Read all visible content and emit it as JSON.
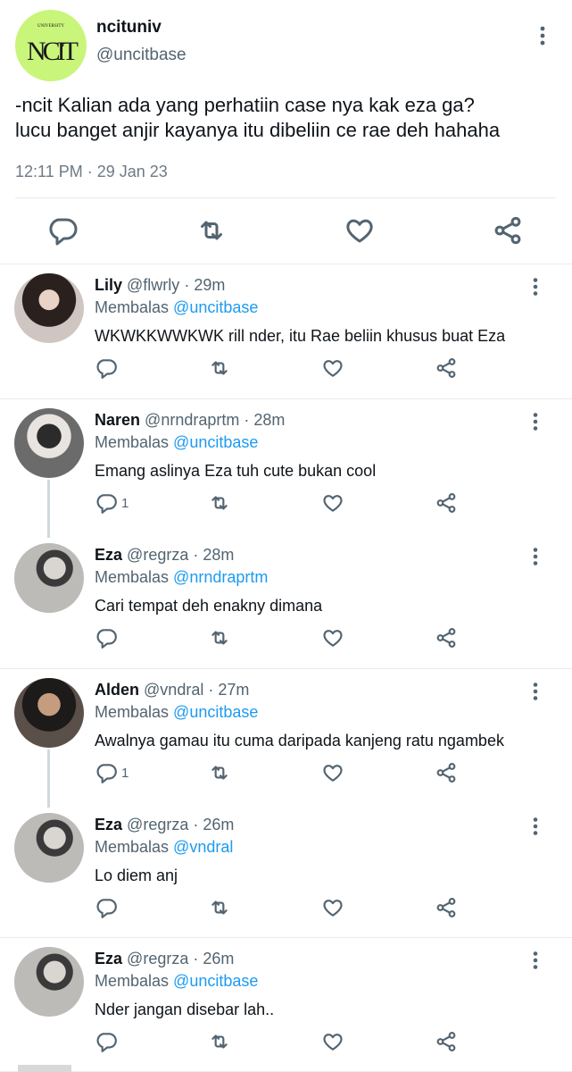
{
  "main_tweet": {
    "display_name": "ncituniv",
    "handle": "@uncitbase",
    "text_line1": "-ncit Kalian ada yang perhatiin case nya kak eza ga?",
    "text_line2": "lucu banget anjir kayanya itu dibeliin ce rae deh hahaha",
    "time": "12:11 PM",
    "separator": "·",
    "date": "29 Jan 23",
    "avatar_logo_text": "NCIT",
    "avatar_logo_subtext": "UNIVERSITY"
  },
  "replies": [
    {
      "name": "Lily",
      "handle": "@flwrly",
      "dot": "·",
      "time": "29m",
      "replying_label": "Membalas",
      "replying_to": "@uncitbase",
      "text": "WKWKKWWKWK rill nder, itu Rae beliin khusus buat Eza",
      "reply_count": ""
    },
    {
      "name": "Naren",
      "handle": "@nrndraprtm",
      "dot": "·",
      "time": "28m",
      "replying_label": "Membalas",
      "replying_to": "@uncitbase",
      "text": "Emang aslinya Eza tuh cute bukan cool",
      "reply_count": "1"
    },
    {
      "name": "Eza",
      "handle": "@regrza",
      "dot": "·",
      "time": "28m",
      "replying_label": "Membalas",
      "replying_to": "@nrndraprtm",
      "text": "Cari tempat deh enakny dimana",
      "reply_count": ""
    },
    {
      "name": "Alden",
      "handle": "@vndral",
      "dot": "·",
      "time": "27m",
      "replying_label": "Membalas",
      "replying_to": "@uncitbase",
      "text": "Awalnya gamau itu cuma daripada kanjeng ratu ngambek",
      "reply_count": "1"
    },
    {
      "name": "Eza",
      "handle": "@regrza",
      "dot": "·",
      "time": "26m",
      "replying_label": "Membalas",
      "replying_to": "@vndral",
      "text": "Lo diem anj",
      "reply_count": ""
    },
    {
      "name": "Eza",
      "handle": "@regrza",
      "dot": "·",
      "time": "26m",
      "replying_label": "Membalas",
      "replying_to": "@uncitbase",
      "text": "Nder jangan disebar lah..",
      "reply_count": ""
    }
  ],
  "icons": {
    "reply": "reply-icon",
    "retweet": "retweet-icon",
    "like": "like-icon",
    "share": "share-icon",
    "more": "more-options-icon"
  },
  "colors": {
    "link": "#1d9bf0",
    "secondary_text": "#536471",
    "avatar_bg": "#c9f57a"
  }
}
